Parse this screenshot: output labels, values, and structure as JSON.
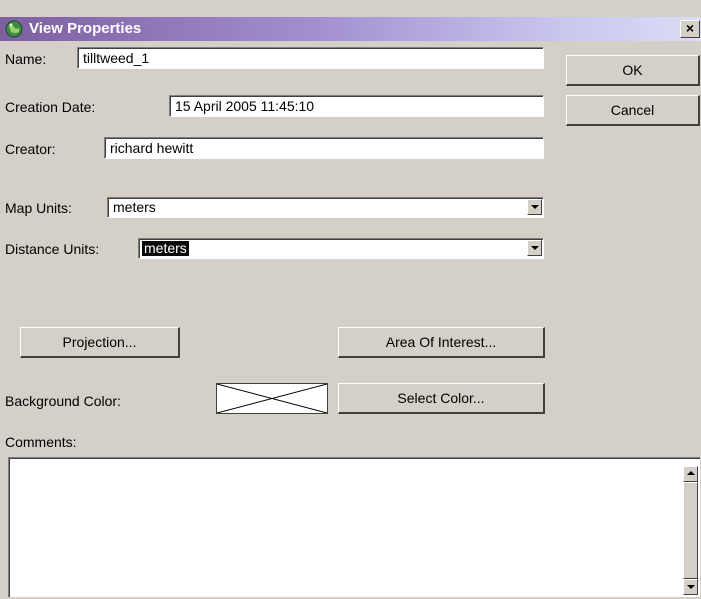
{
  "window": {
    "title": "View Properties",
    "close_label": "×"
  },
  "fields": {
    "name": {
      "label": "Name:",
      "value": "tilltweed_1"
    },
    "creation_date": {
      "label": "Creation Date:",
      "value": "15 April 2005 11:45:10"
    },
    "creator": {
      "label": "Creator:",
      "value": "richard hewitt"
    },
    "map_units": {
      "label": "Map Units:",
      "value": "meters"
    },
    "distance_units": {
      "label": "Distance Units:",
      "value": "meters"
    },
    "background_color": {
      "label": "Background Color:"
    },
    "comments": {
      "label": "Comments:",
      "value": ""
    }
  },
  "buttons": {
    "ok": "OK",
    "cancel": "Cancel",
    "projection": "Projection...",
    "area_of_interest": "Area Of Interest...",
    "select_color": "Select Color..."
  },
  "icons": {
    "title_icon": "globe-icon",
    "swatch": "no-color-cross"
  },
  "colors": {
    "title_start": "#7d5fa0",
    "title_end": "#dcdcf6",
    "face": "#d4d0c8"
  }
}
